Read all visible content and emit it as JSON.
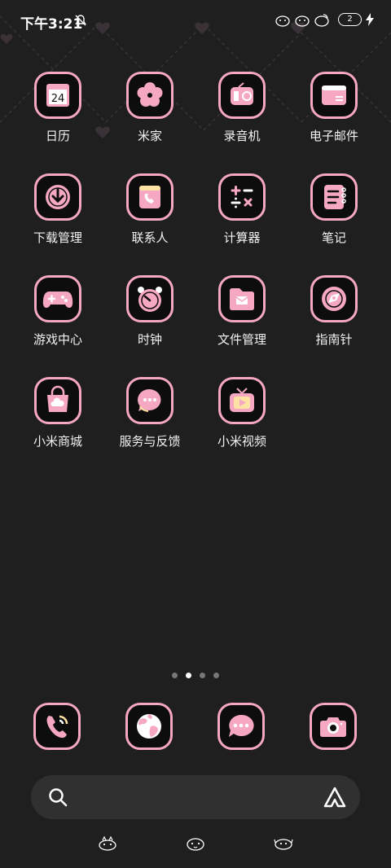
{
  "status_bar": {
    "time": "下午3:21",
    "battery_level": "2",
    "icons": [
      "bell-off-icon",
      "pet-icon",
      "pet-icon",
      "pet-icon",
      "charging-bolt-icon"
    ]
  },
  "apps": [
    {
      "label": "日历",
      "icon": "calendar-icon",
      "date": "24"
    },
    {
      "label": "米家",
      "icon": "flower-icon"
    },
    {
      "label": "录音机",
      "icon": "recorder-icon"
    },
    {
      "label": "电子邮件",
      "icon": "mail-card-icon"
    },
    {
      "label": "下载管理",
      "icon": "download-icon"
    },
    {
      "label": "联系人",
      "icon": "contacts-icon"
    },
    {
      "label": "计算器",
      "icon": "calculator-icon"
    },
    {
      "label": "笔记",
      "icon": "notes-icon"
    },
    {
      "label": "游戏中心",
      "icon": "gamepad-icon"
    },
    {
      "label": "时钟",
      "icon": "clock-icon"
    },
    {
      "label": "文件管理",
      "icon": "folder-icon"
    },
    {
      "label": "指南针",
      "icon": "compass-icon"
    },
    {
      "label": "小米商城",
      "icon": "shopping-bag-icon"
    },
    {
      "label": "服务与反馈",
      "icon": "chat-bubble-icon"
    },
    {
      "label": "小米视频",
      "icon": "tv-icon"
    }
  ],
  "page_indicator": {
    "pages": 4,
    "active": 2
  },
  "dock": [
    "phone-icon",
    "browser-globe-icon",
    "messages-icon",
    "camera-icon"
  ],
  "search": {
    "icon": "search-icon",
    "assistant": "assistant-icon"
  },
  "colors": {
    "accent": "#f6a7c2",
    "tile_bg": "#0d0d0d",
    "background": "#1f1f1f",
    "search_bg": "#303030"
  }
}
